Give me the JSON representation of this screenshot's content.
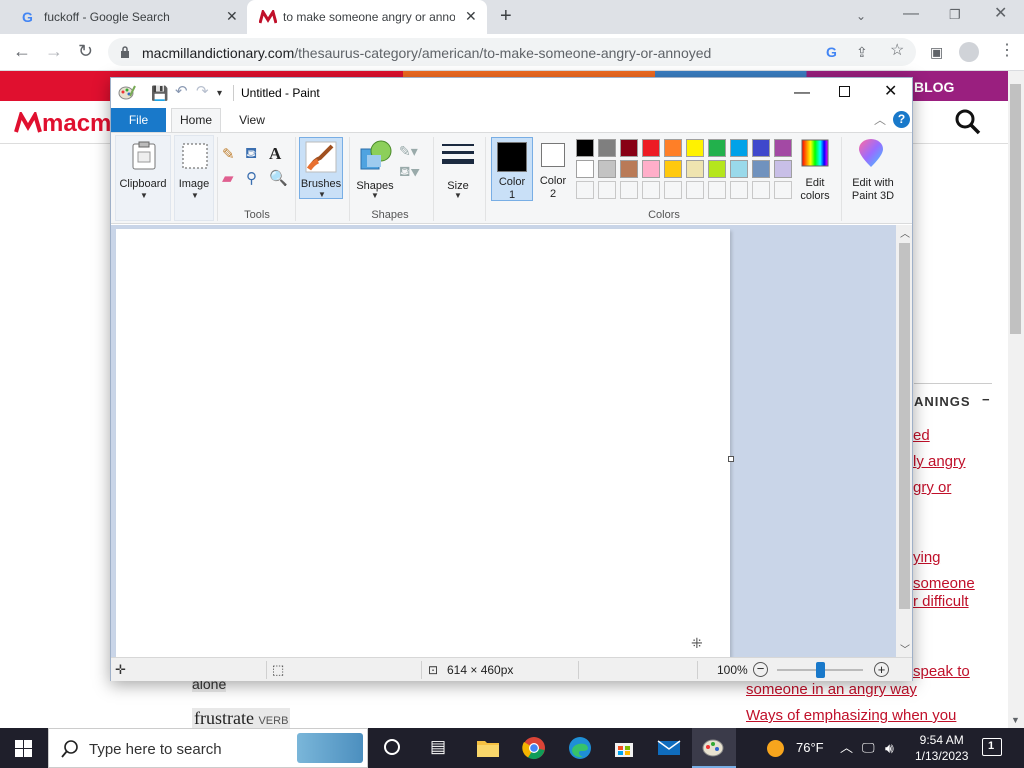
{
  "browser": {
    "tabs": [
      {
        "title": "fuckoff - Google Search",
        "active": false
      },
      {
        "title": "to make someone angry or anno",
        "active": true
      }
    ],
    "url_domain": "macmillandictionary.com",
    "url_path": "/thesaurus-category/american/to-make-someone-angry-or-annoyed"
  },
  "website": {
    "nav_blog": "BLOG",
    "logo_partial": "macm",
    "meanings_header": "ANINGS",
    "meanings_toggle": "−",
    "right_links": [
      "ed",
      "ly angry",
      "gry or",
      "ying",
      "someone",
      "r difficult",
      "speak to",
      "someone in an angry way",
      "Ways of emphasizing when you"
    ],
    "alone_text": "alone",
    "frustrate_word": "frustrate",
    "frustrate_pos": "VERB"
  },
  "paint": {
    "title": "Untitled - Paint",
    "menu": {
      "file": "File",
      "home": "Home",
      "view": "View"
    },
    "ribbon": {
      "clipboard": "Clipboard",
      "image": "Image",
      "tools_group": "Tools",
      "brushes": "Brushes",
      "shapes": "Shapes",
      "shapes_group": "Shapes",
      "size": "Size",
      "color1": "Color 1",
      "color2": "Color 2",
      "colors_group": "Colors",
      "edit_colors": "Edit colors",
      "paint3d": "Edit with Paint 3D"
    },
    "palette_row1": [
      "#000000",
      "#7f7f7f",
      "#880015",
      "#ed1c24",
      "#ff7f27",
      "#fff200",
      "#22b14c",
      "#00a2e8",
      "#3f48cc",
      "#a349a4"
    ],
    "palette_row2": [
      "#ffffff",
      "#c3c3c3",
      "#b97a57",
      "#ffaec9",
      "#ffc90e",
      "#efe4b0",
      "#b5e61d",
      "#99d9ea",
      "#7092be",
      "#c8bfe7"
    ],
    "color1_value": "#000000",
    "color2_value": "#ffffff",
    "status": {
      "size": "614 × 460px",
      "zoom": "100%",
      "zoom_level": 0.5
    }
  },
  "taskbar": {
    "search_placeholder": "Type here to search",
    "weather": "76°F",
    "time": "9:54 AM",
    "date": "1/13/2023",
    "notifications": "1"
  }
}
